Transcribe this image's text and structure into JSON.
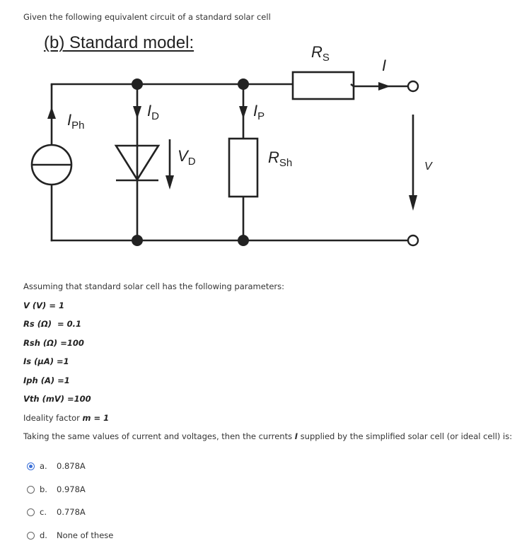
{
  "question": {
    "intro": "Given the following equivalent circuit of a standard solar cell",
    "figure_title": "(b) Standard model:",
    "circuit": {
      "labels": {
        "photo_current": {
          "main": "I",
          "sub": "Ph"
        },
        "diode_current": {
          "main": "I",
          "sub": "D"
        },
        "diode_voltage": {
          "main": "V",
          "sub": "D"
        },
        "shunt_current": {
          "main": "I",
          "sub": "P"
        },
        "shunt_resistor": {
          "main": "R",
          "sub": "Sh"
        },
        "series_resistor": {
          "main": "R",
          "sub": "S"
        },
        "output_current": "I",
        "output_voltage": "V"
      }
    },
    "params_intro": "Assuming that standard solar cell has the following parameters:",
    "params": [
      {
        "label": "V (V)",
        "value": " = 1"
      },
      {
        "label": "Rs (Ω)",
        "value": "  = 0.1"
      },
      {
        "label": "Rsh (Ω)",
        "value": " =100"
      },
      {
        "label": "Is (µA)",
        "value": " =1"
      },
      {
        "label": "Iph (A)",
        "value": " =1"
      },
      {
        "label": "Vth (mV)",
        "value": " =100"
      }
    ],
    "ideality": {
      "prefix": "Ideality factor ",
      "var": "m = 1"
    },
    "prompt": {
      "before": "Taking the same values of current and voltages, then the currents ",
      "var": "I",
      "after": " supplied by the simplified solar cell (or ideal cell) is:"
    },
    "options": [
      {
        "letter": "a.",
        "text": "0.878A",
        "selected": true
      },
      {
        "letter": "b.",
        "text": "0.978A",
        "selected": false
      },
      {
        "letter": "c.",
        "text": "0.778A",
        "selected": false
      },
      {
        "letter": "d.",
        "text": "None of these",
        "selected": false
      }
    ]
  },
  "colors": {
    "accent": "#3a6fd8",
    "ink": "#222222"
  }
}
